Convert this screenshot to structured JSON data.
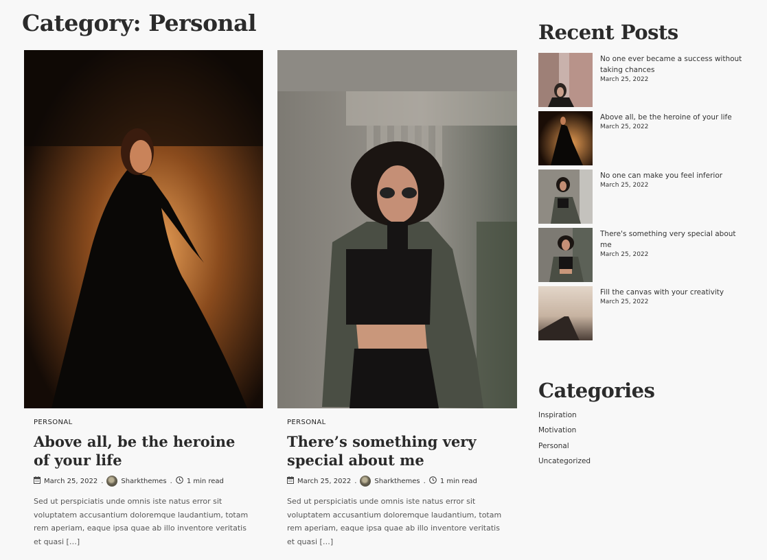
{
  "page": {
    "title": "Category: Personal"
  },
  "posts": [
    {
      "category": "PERSONAL",
      "title": "Above all, be the heroine of your life",
      "date": "March 25, 2022",
      "author": "Sharkthemes",
      "read_time": "1 min read",
      "excerpt": "Sed ut perspiciatis unde omnis iste natus error sit voluptatem accusantium doloremque laudantium, totam rem aperiam, eaque ipsa quae ab illo inventore veritatis et quasi […]"
    },
    {
      "category": "PERSONAL",
      "title": "There’s something very special about me",
      "date": "March 25, 2022",
      "author": "Sharkthemes",
      "read_time": "1 min read",
      "excerpt": "Sed ut perspiciatis unde omnis iste natus error sit voluptatem accusantium doloremque laudantium, totam rem aperiam, eaque ipsa quae ab illo inventore veritatis et quasi […]"
    }
  ],
  "sidebar": {
    "recent_title": "Recent Posts",
    "recent": [
      {
        "title": "No one ever became a success without taking chances",
        "date": "March 25, 2022"
      },
      {
        "title": "Above all, be the heroine of your life",
        "date": "March 25, 2022"
      },
      {
        "title": "No one can make you feel inferior",
        "date": "March 25, 2022"
      },
      {
        "title": "There's something very special about me",
        "date": "March 25, 2022"
      },
      {
        "title": "Fill the canvas with your creativity",
        "date": "March 25, 2022"
      }
    ],
    "categories_title": "Categories",
    "categories": [
      "Inspiration",
      "Motivation",
      "Personal",
      "Uncategorized"
    ]
  },
  "icons": {
    "date": "calendar-icon",
    "author": "avatar",
    "time": "clock-icon"
  }
}
